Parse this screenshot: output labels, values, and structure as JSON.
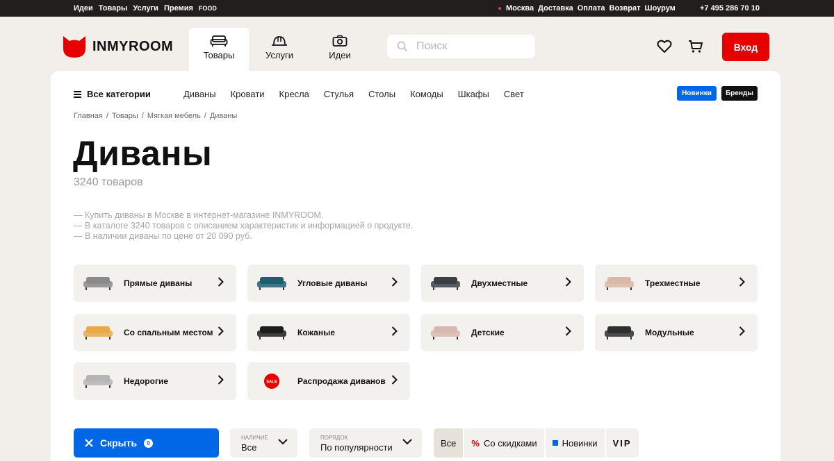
{
  "topbar": {
    "left": [
      "Идеи",
      "Товары",
      "Услуги",
      "Премия",
      "FOOD"
    ],
    "city": "Москва",
    "right": [
      "Доставка",
      "Оплата",
      "Возврат",
      "Шоурум"
    ],
    "phone": "+7 495 286 70 10"
  },
  "header": {
    "logo_text": "INMYROOM",
    "tabs": [
      {
        "label": "Товары",
        "icon": "sofa-icon"
      },
      {
        "label": "Услуги",
        "icon": "helmet-icon"
      },
      {
        "label": "Идеи",
        "icon": "camera-icon"
      }
    ],
    "search_placeholder": "Поиск",
    "login_label": "Вход"
  },
  "catbar": {
    "all_label": "Все категории",
    "items": [
      "Диваны",
      "Кровати",
      "Кресла",
      "Стулья",
      "Столы",
      "Комоды",
      "Шкафы",
      "Свет"
    ],
    "tag_new": "Новинки",
    "tag_brands": "Бренды"
  },
  "breadcrumb": [
    "Главная",
    "Товары",
    "Мягкая мебель",
    "Диваны"
  ],
  "page": {
    "title": "Диваны",
    "count": "3240 товаров",
    "desc": [
      "— Купить диваны в Москве в интернет-магазине INMYROOM.",
      "— В каталоге 3240 товаров с описанием характеристик и информацией о продукте.",
      "— В наличии диваны по цене от 20 090 руб."
    ]
  },
  "categories": [
    {
      "label": "Прямые диваны",
      "color": "#8a8a8a"
    },
    {
      "label": "Угловые диваны",
      "color": "#1f5e6e"
    },
    {
      "label": "Двухместные",
      "color": "#3b4046"
    },
    {
      "label": "Трехместные",
      "color": "#d9b8aa"
    },
    {
      "label": "Со спальным местом",
      "color": "#e8a94a"
    },
    {
      "label": "Кожаные",
      "color": "#1d1d1d"
    },
    {
      "label": "Детские",
      "color": "#d8b8b0"
    },
    {
      "label": "Модульные",
      "color": "#2e2e2e"
    },
    {
      "label": "Недорогие",
      "color": "#b5b5b5"
    },
    {
      "label": "Распродажа диванов",
      "color": "#e60000",
      "badge": "SALE"
    }
  ],
  "filters": {
    "hide_label": "Скрыть",
    "hide_count": "0",
    "availability": {
      "caption": "НАЛИЧИЕ",
      "value": "Все"
    },
    "order": {
      "caption": "ПОРЯДОК",
      "value": "По популярности"
    },
    "segments": [
      "Все",
      "Со скидками",
      "Новинки",
      "VIP"
    ]
  },
  "colors": {
    "accent": "#e60000",
    "blue": "#0067e6",
    "dark": "#211e1d"
  }
}
